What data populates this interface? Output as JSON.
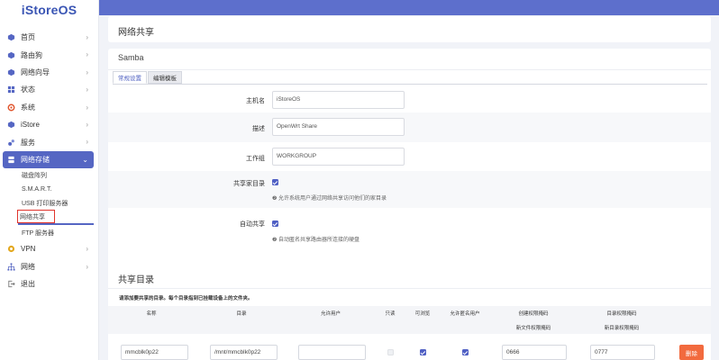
{
  "app": {
    "logo": "iStoreOS"
  },
  "sidebar": {
    "items": [
      {
        "label": "首页",
        "icon": "home-icon",
        "color": "#5566c3"
      },
      {
        "label": "路由狗",
        "icon": "dog-icon",
        "color": "#5566c3"
      },
      {
        "label": "网络向导",
        "icon": "wizard-icon",
        "color": "#5566c3"
      },
      {
        "label": "状态",
        "icon": "status-icon",
        "color": "#5566c3"
      },
      {
        "label": "系统",
        "icon": "system-gear-icon",
        "color": "#e0542c"
      },
      {
        "label": "iStore",
        "icon": "istore-icon",
        "color": "#5566c3"
      },
      {
        "label": "服务",
        "icon": "service-icon",
        "color": "#5566c3"
      },
      {
        "label": "网络存储",
        "icon": "storage-icon",
        "color": "#ffffff"
      }
    ],
    "storage_sub": [
      "磁盘阵列",
      "S.M.A.R.T.",
      "USB 打印服务器",
      "网络共享",
      "FTP 服务器"
    ],
    "bottom_items": [
      {
        "label": "VPN",
        "icon": "vpn-icon",
        "color": "#e3a81f"
      },
      {
        "label": "网络",
        "icon": "network-icon",
        "color": "#5566c3"
      },
      {
        "label": "退出",
        "icon": "logout-icon",
        "color": "#777777"
      }
    ]
  },
  "page": {
    "title": "网络共享"
  },
  "samba": {
    "title": "Samba",
    "tabs": [
      "常规设置",
      "编辑模板"
    ],
    "hostname_label": "主机名",
    "hostname_value": "iStoreOS",
    "desc_label": "描述",
    "desc_value": "OpenWrt Share",
    "workgroup_label": "工作组",
    "workgroup_value": "WORKGROUP",
    "homes_label": "共享家目录",
    "homes_hint": "❷ 允许系统用户通过网络共享访问他们的家目录",
    "homes_checked": true,
    "autoshare_label": "自动共享",
    "autoshare_hint": "❷ 自动匿名共享路由器所连接的硬盘",
    "autoshare_checked": true
  },
  "share_dirs": {
    "title": "共享目录",
    "note": "请添加要共享的目录。每个目录指到已挂载设备上的文件夹。",
    "headers": {
      "name": "名称",
      "path": "目录",
      "users": "允许用户",
      "readonly": "只读",
      "browseable": "可浏览",
      "guest": "允许匿名用户",
      "create_mask": "创建权限掩码",
      "create_mask_sub": "新文件权限掩码",
      "dir_mask": "目录权限掩码",
      "dir_mask_sub": "新目录权限掩码"
    },
    "rows": [
      {
        "name": "mmcblk0p22",
        "path": "/mnt/mmcblk0p22",
        "users": "",
        "readonly": false,
        "browseable": true,
        "guest": true,
        "create_mask": "0666",
        "dir_mask": "0777",
        "delete_label": "删除"
      }
    ]
  },
  "colors": {
    "accent": "#5566c3",
    "header": "#5d6fcc",
    "danger": "#f26a3e"
  }
}
